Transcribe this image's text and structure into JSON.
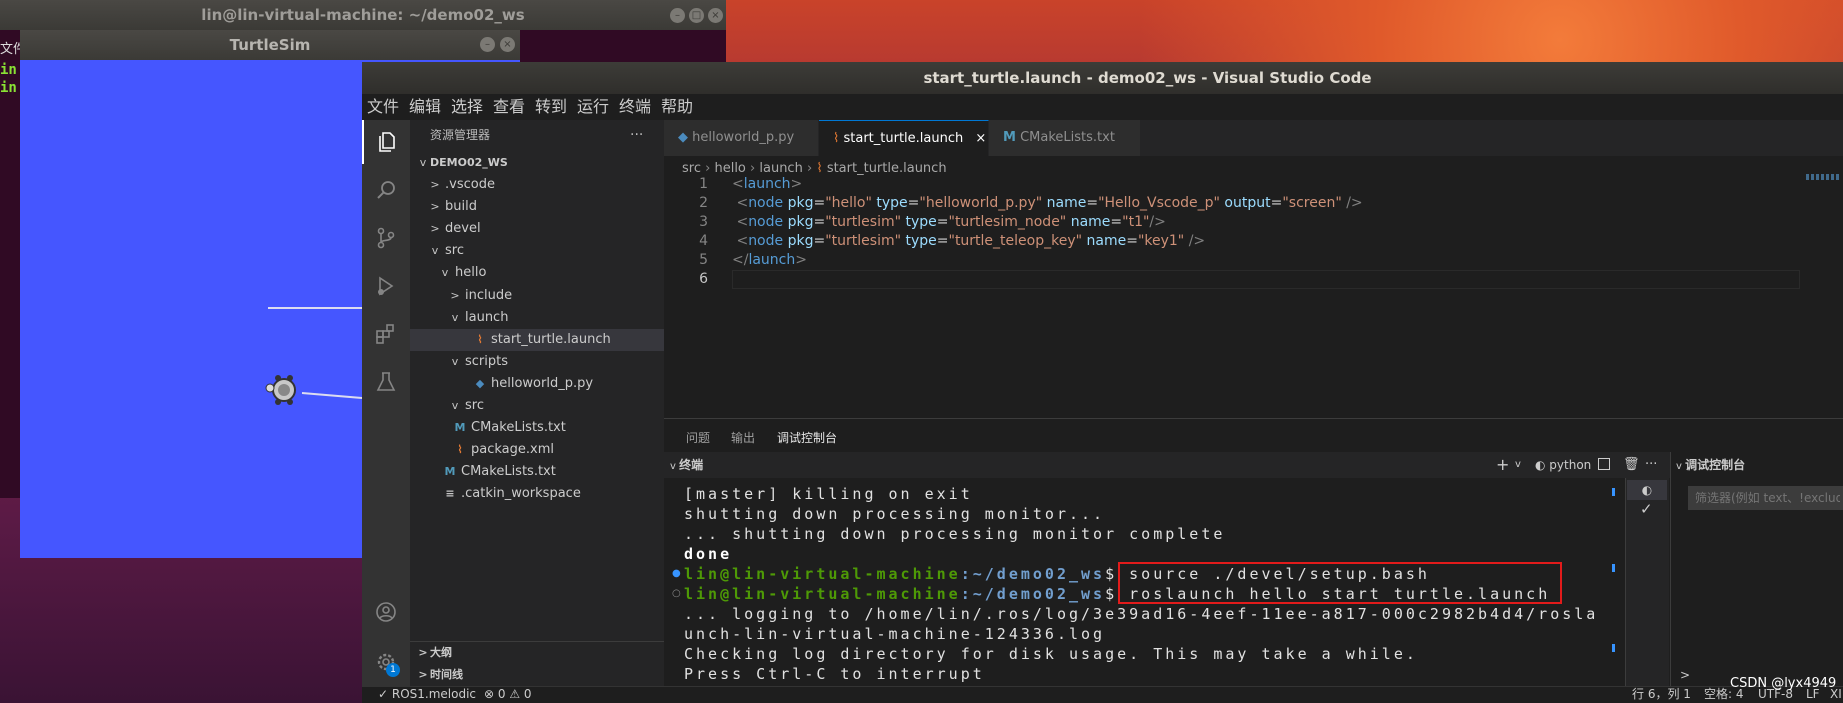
{
  "background_terminal": {
    "title": "lin@lin-virtual-machine: ~/demo02_ws",
    "left_strip_text": "文件",
    "left_strip_lines": [
      "in",
      "in"
    ]
  },
  "turtlesim": {
    "title": "TurtleSim",
    "bg_color": "#4556ff"
  },
  "vscode": {
    "title": "start_turtle.launch - demo02_ws - Visual Studio Code",
    "menu": [
      "文件",
      "编辑",
      "选择",
      "查看",
      "转到",
      "运行",
      "终端",
      "帮助"
    ],
    "activity_icons": [
      "files-icon",
      "search-icon",
      "source-control-icon",
      "run-debug-icon",
      "extensions-icon",
      "testing-icon"
    ],
    "explorer": {
      "title": "资源管理器",
      "more": "···",
      "workspace": "DEMO02_WS",
      "items": [
        {
          "label": ".vscode",
          "twisty": ">",
          "icon": ""
        },
        {
          "label": "build",
          "twisty": ">",
          "icon": ""
        },
        {
          "label": "devel",
          "twisty": ">",
          "icon": ""
        },
        {
          "label": "src",
          "twisty": "v",
          "icon": ""
        },
        {
          "label": "hello",
          "twisty": "v",
          "icon": ""
        },
        {
          "label": "include",
          "twisty": ">",
          "icon": ""
        },
        {
          "label": "launch",
          "twisty": "v",
          "icon": ""
        },
        {
          "label": "start_turtle.launch",
          "twisty": "",
          "icon": "rss-icon"
        },
        {
          "label": "scripts",
          "twisty": "v",
          "icon": ""
        },
        {
          "label": "helloworld_p.py",
          "twisty": "",
          "icon": "python-icon"
        },
        {
          "label": "src",
          "twisty": "v",
          "icon": ""
        },
        {
          "label": "CMakeLists.txt",
          "twisty": "",
          "icon": "cmake-icon"
        },
        {
          "label": "package.xml",
          "twisty": "",
          "icon": "rss-icon"
        },
        {
          "label": "CMakeLists.txt",
          "twisty": "",
          "icon": "cmake-icon"
        },
        {
          "label": ".catkin_workspace",
          "twisty": "",
          "icon": "lines-icon"
        }
      ],
      "outline": "大纲",
      "timeline": "时间线"
    },
    "tabs": [
      {
        "label": "helloworld_p.py",
        "icon": "python-icon"
      },
      {
        "label": "start_turtle.launch",
        "icon": "rss-icon",
        "close": "×"
      },
      {
        "label": "CMakeLists.txt",
        "icon": "cmake-icon"
      }
    ],
    "breadcrumb": [
      "src",
      "hello",
      "launch",
      "start_turtle.launch"
    ],
    "code": {
      "line_numbers": [
        "1",
        "2",
        "3",
        "4",
        "5",
        "6"
      ],
      "l1": {
        "open": "<",
        "tag": "launch",
        "close": ">"
      },
      "l2": {
        "open": "<",
        "tag": "node",
        "a1": "pkg",
        "v1": "\"hello\"",
        "a2": "type",
        "v2": "\"helloworld_p.py\"",
        "a3": "name",
        "v3": "\"Hello_Vscode_p\"",
        "a4": "output",
        "v4": "\"screen\"",
        "end": "/>"
      },
      "l3": {
        "open": "<",
        "tag": "node",
        "a1": "pkg",
        "v1": "\"turtlesim\"",
        "a2": "type",
        "v2": "\"turtlesim_node\"",
        "a3": "name",
        "v3": "\"t1\"",
        "end": "/>"
      },
      "l4": {
        "open": "<",
        "tag": "node",
        "a1": "pkg",
        "v1": "\"turtlesim\"",
        "a2": "type",
        "v2": "\"turtle_teleop_key\"",
        "a3": "name",
        "v3": "\"key1\"",
        "end": "/>"
      },
      "l5": {
        "open": "</",
        "tag": "launch",
        "close": ">"
      },
      "eq": "="
    },
    "panel_tabs": [
      "问题",
      "输出",
      "调试控制台"
    ],
    "terminal": {
      "header": "终端",
      "shell_label": "python",
      "add": "+",
      "lines": [
        "[master] killing on exit",
        "shutting down processing monitor...",
        "... shutting down processing monitor complete",
        "done"
      ],
      "prompt_user": "lin@lin-virtual-machine",
      "prompt_path": ":~/demo02_ws",
      "prompt_sym": "$ ",
      "cmd1": "source ./devel/setup.bash",
      "cmd2": "roslaunch hello start_turtle.launch",
      "out_lines": [
        "... logging to /home/lin/.ros/log/3e39ad16-4eef-11ee-a817-000c2982b4d4/rosla",
        "unch-lin-virtual-machine-124336.log",
        "Checking log directory for disk usage. This may take a while.",
        "Press Ctrl-C to interrupt"
      ]
    },
    "debug_console": {
      "header": "调试控制台",
      "filter_placeholder": "筛选器(例如 text、!exclude)",
      "check": "✓"
    },
    "status": {
      "branch": "ROS1.melodic",
      "problems": "⊗ 0 ⚠ 0",
      "position": "行 6，列 1",
      "spaces": "空格: 4",
      "encoding": "UTF-8",
      "eol": "LF",
      "lang": "XI"
    }
  },
  "watermark": "CSDN @lyx4949",
  "colors": {
    "accent": "#0078d4",
    "highlight_box": "#e21b1b",
    "prompt_green": "#4e9a06",
    "prompt_blue": "#729fcf"
  }
}
